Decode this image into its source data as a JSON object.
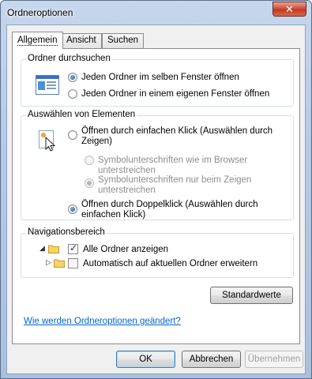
{
  "window": {
    "title": "Ordneroptionen",
    "close_label": "✕"
  },
  "tabs": [
    {
      "label": "Allgemein",
      "active": true
    },
    {
      "label": "Ansicht",
      "active": false
    },
    {
      "label": "Suchen",
      "active": false
    }
  ],
  "browse_folders": {
    "title": "Ordner durchsuchen",
    "options": [
      {
        "label": "Jeden Ordner im selben Fenster öffnen",
        "checked": true
      },
      {
        "label": "Jeden Ordner in einem eigenen Fenster öffnen",
        "checked": false
      }
    ]
  },
  "click_items": {
    "title": "Auswählen von Elementen",
    "single_click": "Öffnen durch einfachen Klick (Auswählen durch Zeigen)",
    "underline_browser": "Symbolunterschriften wie im Browser unterstreichen",
    "underline_hover": "Symbolunterschriften nur beim Zeigen unterstreichen",
    "double_click": "Öffnen durch Doppelklick (Auswählen durch einfachen Klick)"
  },
  "navigation_pane": {
    "title": "Navigationsbereich",
    "show_all_folders": "Alle Ordner anzeigen",
    "show_all_folders_checked": true,
    "auto_expand": "Automatisch auf aktuellen Ordner erweitern",
    "auto_expand_checked": false
  },
  "restore_defaults": "Standardwerte",
  "help_link": "Wie werden Ordneroptionen geändert?",
  "buttons": {
    "ok": "OK",
    "cancel": "Abbrechen",
    "apply": "Übernehmen"
  }
}
